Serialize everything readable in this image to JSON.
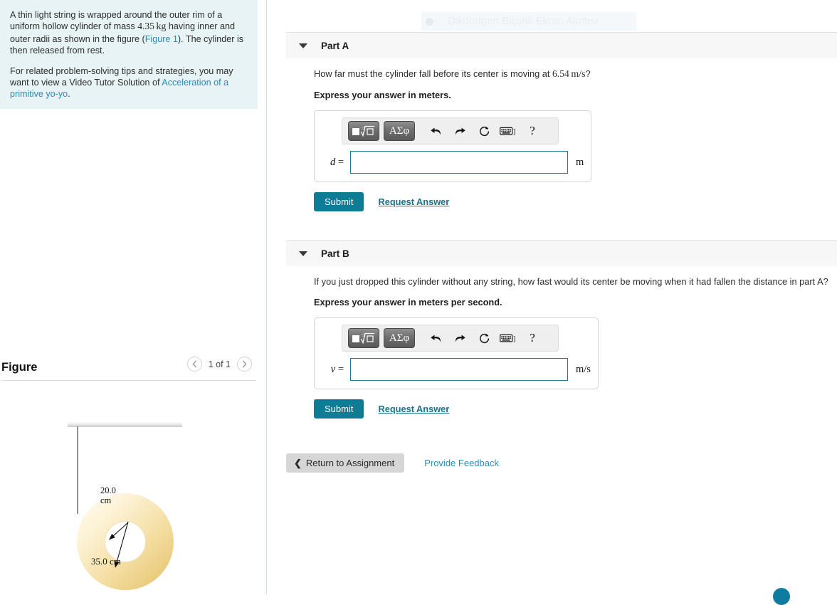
{
  "snip_overlay": {
    "label": "Dikdörtgen Biçimli Ekran Alıntısı",
    "dot_icon": "record-dot-icon"
  },
  "problem": {
    "paragraph1_pre": "A thin light string is wrapped around the outer rim of a uniform hollow cylinder of mass ",
    "mass_value": "4.35",
    "mass_unit": "kg",
    "paragraph1_mid": " having inner and outer radii as shown in the figure (",
    "figure_link": "Figure 1",
    "paragraph1_post": "). The cylinder is then released from rest.",
    "paragraph2_pre": "For related problem-solving tips and strategies, you may want to view a Video Tutor Solution of ",
    "tutor_link": "Acceleration of a primitive yo-yo",
    "paragraph2_post": "."
  },
  "figure": {
    "title": "Figure",
    "counter": "1 of 1",
    "prev_icon": "chevron-left-icon",
    "next_icon": "chevron-right-icon",
    "inner_label_line1": "20.0",
    "inner_label_line2": "cm",
    "outer_label": "35.0 cm",
    "accent_gold": "#e9c97a"
  },
  "toolbar": {
    "template_button_label": "math-template",
    "greek_button_label": "ΑΣφ",
    "undo_icon": "undo-arrow-icon",
    "redo_icon": "redo-arrow-icon",
    "reset_icon": "reset-circular-arrow-icon",
    "keyboard_icon": "keyboard-icon",
    "help_label": "?"
  },
  "parts": [
    {
      "id": "part-a",
      "label": "Part A",
      "caret_icon": "caret-down-icon",
      "question_pre": "How far must the cylinder fall before its center is moving at ",
      "question_value": "6.54",
      "question_unit": "m/s",
      "question_post": "?",
      "instruction": "Express your answer in meters.",
      "variable": "d",
      "equals": "=",
      "input_value": "",
      "input_placeholder": "",
      "unit": "m",
      "submit_label": "Submit",
      "request_label": "Request Answer"
    },
    {
      "id": "part-b",
      "label": "Part B",
      "caret_icon": "caret-down-icon",
      "question_pre": "If you just dropped this cylinder without any string, how fast would its center be moving when it had fallen the distance in part A?",
      "question_value": "",
      "question_unit": "",
      "question_post": "",
      "instruction": "Express your answer in meters per second.",
      "variable": "v",
      "equals": "=",
      "input_value": "",
      "input_placeholder": "",
      "unit": "m/s",
      "submit_label": "Submit",
      "request_label": "Request Answer"
    }
  ],
  "footer": {
    "return_label": "Return to Assignment",
    "return_icon": "chevron-left-icon",
    "feedback_label": "Provide Feedback"
  },
  "colors": {
    "submit_teal": "#0f7c95",
    "link_blue": "#2b8cb8",
    "panel_mint": "#e7f3f4",
    "part_header_gray": "#f7f7f7"
  }
}
